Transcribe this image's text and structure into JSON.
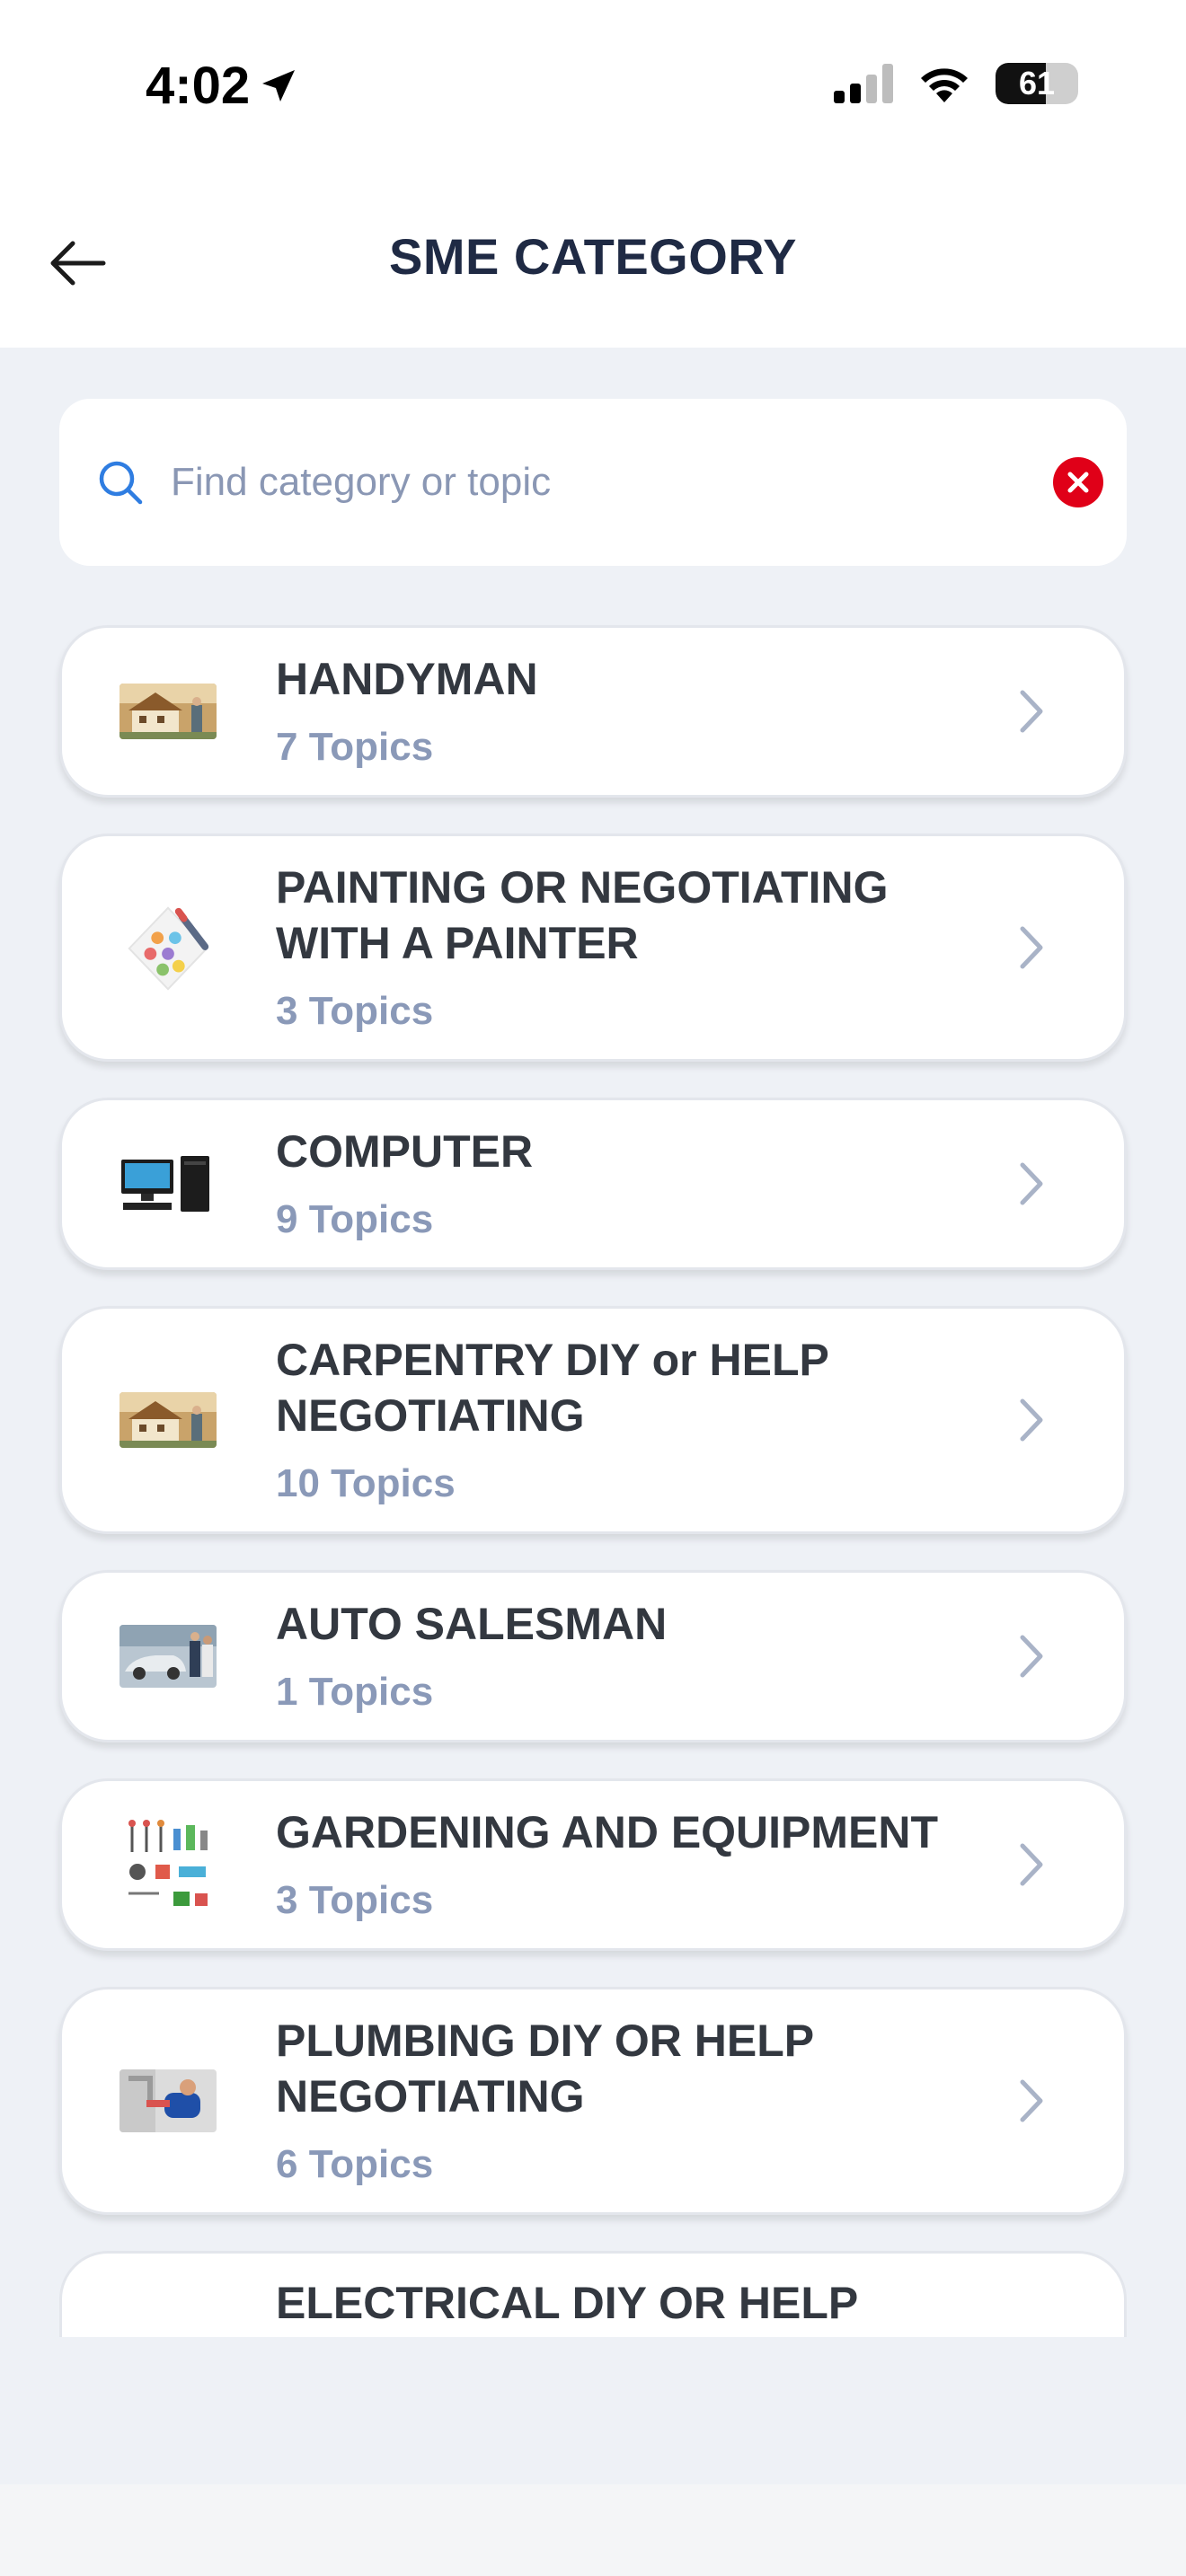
{
  "status_bar": {
    "time": "4:02",
    "battery": "61"
  },
  "header": {
    "title": "SME CATEGORY"
  },
  "search": {
    "placeholder": "Find category or topic",
    "value": ""
  },
  "categories": [
    {
      "title": "HANDYMAN",
      "count": "7 Topics",
      "icon": "house-photo"
    },
    {
      "title": "PAINTING OR NEGOTIATING WITH A PAINTER",
      "count": "3 Topics",
      "icon": "palette"
    },
    {
      "title": "COMPUTER",
      "count": "9 Topics",
      "icon": "computer-photo"
    },
    {
      "title": "CARPENTRY DIY or HELP NEGOTIATING",
      "count": "10 Topics",
      "icon": "house-photo"
    },
    {
      "title": "AUTO SALESMAN",
      "count": "1 Topics",
      "icon": "car-photo"
    },
    {
      "title": "GARDENING AND EQUIPMENT",
      "count": "3 Topics",
      "icon": "garden-tools"
    },
    {
      "title": "PLUMBING DIY OR HELP NEGOTIATING",
      "count": "6 Topics",
      "icon": "plumber-photo"
    },
    {
      "title": "ELECTRICAL DIY OR HELP",
      "count": "",
      "icon": ""
    }
  ],
  "colors": {
    "title": "#1f2a44",
    "muted": "#8a99b8",
    "clear": "#e00018",
    "accent": "#2f7de1"
  }
}
